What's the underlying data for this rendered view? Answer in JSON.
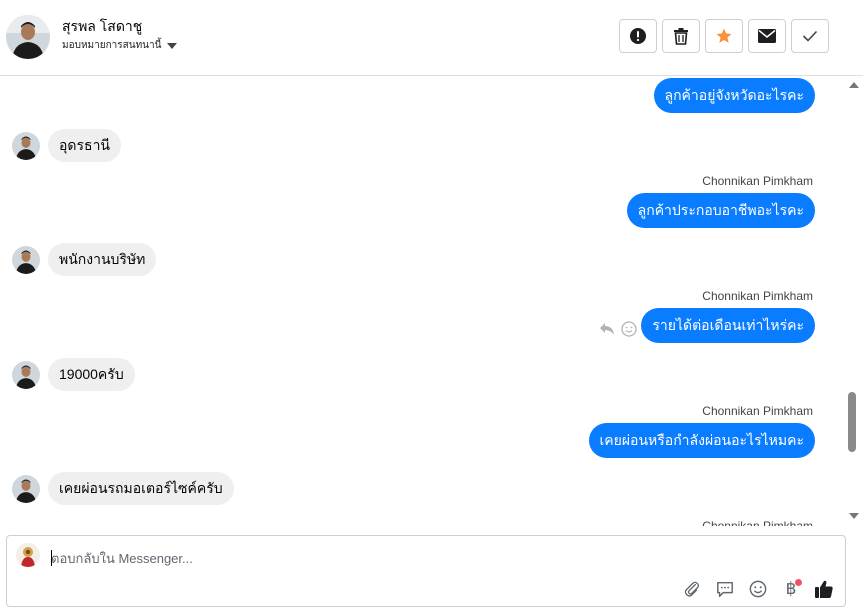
{
  "header": {
    "contact_name": "สุรพล โสดาชู",
    "assign_label": "มอบหมายการสนทนานี้",
    "actions": [
      {
        "icon": "alert-icon",
        "label": "Mark as spam"
      },
      {
        "icon": "trash-icon",
        "label": "Delete"
      },
      {
        "icon": "star-icon",
        "label": "Star"
      },
      {
        "icon": "envelope-icon",
        "label": "Mark as unread"
      },
      {
        "icon": "check-icon",
        "label": "Done"
      }
    ]
  },
  "colors": {
    "outgoing_bubble": "#0a7cff",
    "incoming_bubble": "#efefef",
    "star": "#f7923a"
  },
  "messages": [
    {
      "direction": "out",
      "text": "ลูกค้าอยู่จังหวัดอะไรคะ"
    },
    {
      "direction": "in",
      "text": "อุดรธานี"
    },
    {
      "direction": "out",
      "sender": "Chonnikan Pimkham",
      "text": "ลูกค้าประกอบอาชีพอะไรคะ"
    },
    {
      "direction": "in",
      "text": "พนักงานบริษัท"
    },
    {
      "direction": "out",
      "sender": "Chonnikan Pimkham",
      "text": "รายได้ต่อเดือนเท่าไหร่คะ",
      "hover_tools": [
        "reply-icon",
        "emoji-react-icon"
      ]
    },
    {
      "direction": "in",
      "text": "19000ครับ"
    },
    {
      "direction": "out",
      "sender": "Chonnikan Pimkham",
      "text": "เคยผ่อนหรือกำลังผ่อนอะไรไหมคะ"
    },
    {
      "direction": "in",
      "text": "เคยผ่อนรถมอเตอร์ไซค์ครับ"
    },
    {
      "direction": "out",
      "sender": "Chonnikan Pimkham",
      "text": ""
    }
  ],
  "composer": {
    "placeholder": "ตอบกลับใน Messenger...",
    "tools": [
      "attachment-icon",
      "saved-replies-icon",
      "emoji-icon",
      "payment-baht-icon",
      "like-icon"
    ]
  }
}
